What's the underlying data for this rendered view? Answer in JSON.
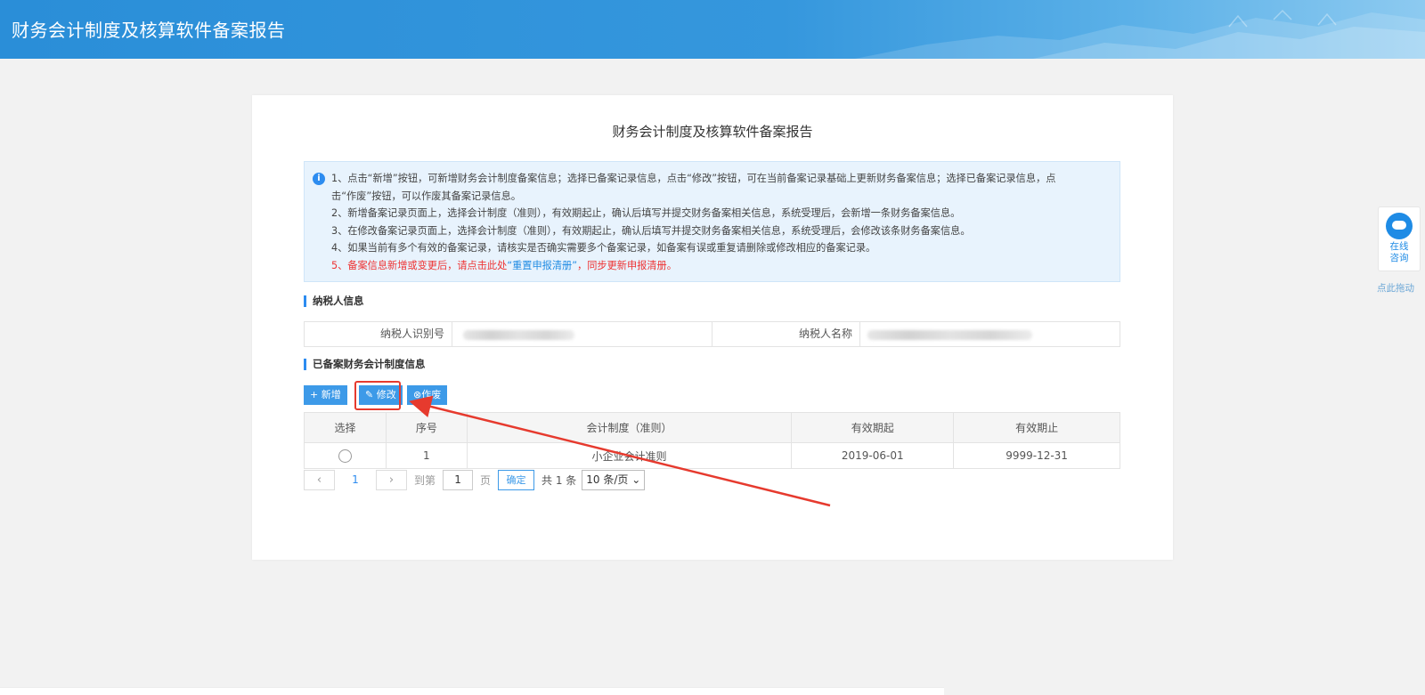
{
  "header": {
    "title": "财务会计制度及核算软件备案报告"
  },
  "card": {
    "title": "财务会计制度及核算软件备案报告"
  },
  "notice": {
    "line1a": "1、点击“新增”按钮，可新增财务会计制度备案信息；选择已备案记录信息，点击“修改”按钮，可在当前备案记录基础上更新财务备案信息；选择已备案记录信息，点",
    "line1b": "击“作废”按钮，可以作废其备案记录信息。",
    "line2": "2、新增备案记录页面上，选择会计制度（准则），有效期起止，确认后填写并提交财务备案相关信息，系统受理后，会新增一条财务备案信息。",
    "line3": "3、在修改备案记录页面上，选择会计制度（准则），有效期起止，确认后填写并提交财务备案相关信息，系统受理后，会修改该条财务备案信息。",
    "line4": "4、如果当前有多个有效的备案记录，请核实是否确实需要多个备案记录，如备案有误或重复请删除或修改相应的备案记录。",
    "line5_prefix": "5、备案信息新增或变更后，请点击此处",
    "line5_link": "“重置申报清册”",
    "line5_suffix": "，同步更新申报清册。"
  },
  "taxpayer": {
    "section_title": "纳税人信息",
    "id_label": "纳税人识别号",
    "name_label": "纳税人名称"
  },
  "records": {
    "section_title": "已备案财务会计制度信息",
    "toolbar": {
      "add": "+ 新增",
      "edit": "修改",
      "void": "作废"
    },
    "columns": [
      "选择",
      "序号",
      "会计制度（准则）",
      "有效期起",
      "有效期止"
    ],
    "rows": [
      {
        "seq": "1",
        "standard": "小企业会计准则",
        "start": "2019-06-01",
        "end": "9999-12-31"
      }
    ]
  },
  "pager": {
    "prev": "‹",
    "page": "1",
    "next": "›",
    "goto_label": "到第",
    "goto_value": "1",
    "page_unit": "页",
    "ok": "确定",
    "total": "共 1 条",
    "page_size": "10 条/页"
  },
  "help": {
    "line1": "在线",
    "line2": "咨询",
    "drag_tip": "点此拖动"
  },
  "colors": {
    "header": "#2a8ed8",
    "primary": "#3d9ae8",
    "annotation": "#e63a2e",
    "notice_red": "#e33333"
  }
}
